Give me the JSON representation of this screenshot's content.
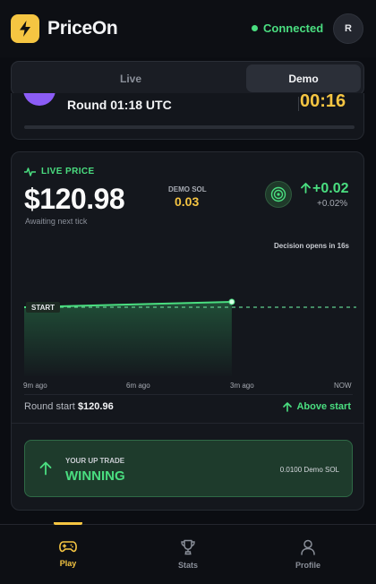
{
  "header": {
    "brand": "PriceOn",
    "status": "Connected",
    "avatar_initial": "R",
    "brand_color": "#f5c542"
  },
  "mode_tabs": [
    {
      "label": "Live",
      "active": false
    },
    {
      "label": "Demo",
      "active": true
    }
  ],
  "round": {
    "label": "Round 01:18 UTC",
    "timer": "00:16",
    "progress": 0.0
  },
  "price_card": {
    "live_label": "LIVE PRICE",
    "price": "$120.98",
    "tick_status": "Awaiting next tick",
    "demo_sol_label": "DEMO SOL",
    "demo_sol_value": "0.03",
    "change": "+0.02",
    "change_pct": "+0.02%",
    "decision_text": "Decision opens in 16s"
  },
  "chart_data": {
    "type": "area",
    "x_labels": [
      "9m ago",
      "6m ago",
      "3m ago",
      "NOW"
    ],
    "start_marker": "START",
    "reference_value": 120.96,
    "points": [
      {
        "x": 0.0,
        "y": 120.96
      },
      {
        "x": 1.0,
        "y": 120.98
      }
    ],
    "x_range": [
      0,
      1.6
    ],
    "color": "#4ade80"
  },
  "round_summary": {
    "start_label": "Round start",
    "start_price": "$120.96",
    "direction": "Above start"
  },
  "trade": {
    "label": "YOUR UP TRADE",
    "status": "WINNING",
    "amount": "0.0100 Demo SOL"
  },
  "nav": [
    {
      "label": "Play",
      "icon": "gamepad-icon",
      "active": true,
      "color": "#f5c542"
    },
    {
      "label": "Stats",
      "icon": "trophy-icon",
      "active": false,
      "color": "#8a8f99"
    },
    {
      "label": "Profile",
      "icon": "user-icon",
      "active": false,
      "color": "#8a8f99"
    }
  ]
}
